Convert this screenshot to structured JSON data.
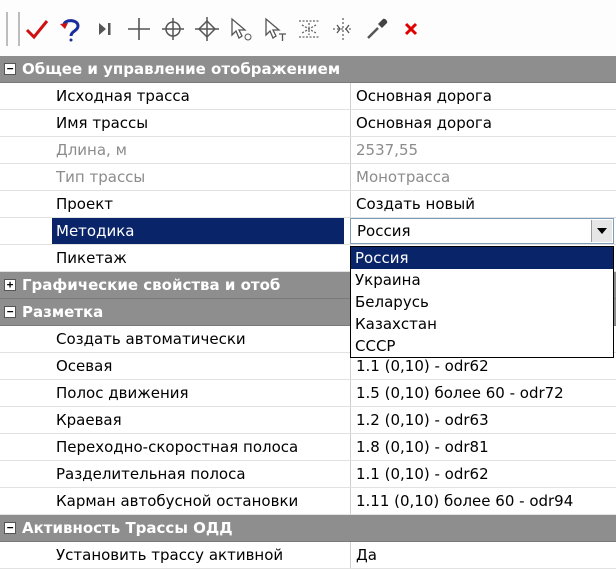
{
  "toolbar": {
    "buttons": [
      {
        "icon": "apply-check-icon"
      },
      {
        "icon": "undo-icon"
      },
      {
        "icon": "step-forward-icon"
      },
      {
        "icon": "add-point-icon"
      },
      {
        "icon": "node-icon"
      },
      {
        "icon": "node-move-icon"
      },
      {
        "icon": "select-cursor-icon"
      },
      {
        "icon": "select-text-cursor-icon"
      },
      {
        "icon": "road-cross-icon"
      },
      {
        "icon": "picket-icon"
      },
      {
        "icon": "pipette-icon"
      },
      {
        "icon": "delete-icon"
      }
    ]
  },
  "categories": [
    {
      "title": "Общее и управление отображением",
      "expander": "−",
      "rows": [
        {
          "name": "Исходная трасса",
          "value": "Основная дорога"
        },
        {
          "name": "Имя трассы",
          "value": "Основная дорога"
        },
        {
          "name": "Длина, м",
          "value": "2537,55"
        },
        {
          "name": "Тип трассы",
          "value": "Монотрасса"
        },
        {
          "name": "Проект",
          "value": "Создать новый"
        },
        {
          "name": "Методика",
          "value": "Россия"
        },
        {
          "name": "Пикетаж",
          "value": ""
        }
      ]
    },
    {
      "title": "Графические свойства и отоб",
      "expander": "+"
    },
    {
      "title": "Разметка",
      "expander": "−",
      "rows": [
        {
          "name": "Создать автоматически",
          "value": ""
        },
        {
          "name": "Осевая",
          "value": "1.1 (0,10) - odr62"
        },
        {
          "name": "Полос движения",
          "value": "1.5 (0,10) более 60 - odr72"
        },
        {
          "name": "Краевая",
          "value": "1.2 (0,10) - odr63"
        },
        {
          "name": "Переходно-скоростная полоса",
          "value": "1.8 (0,10) - odr81"
        },
        {
          "name": "Разделительная полоса",
          "value": "1.1 (0,10) - odr62"
        },
        {
          "name": "Карман автобусной остановки",
          "value": "1.11 (0,10) более 60 - odr94"
        }
      ]
    },
    {
      "title": "Активность Трассы ОДД",
      "expander": "−",
      "rows": [
        {
          "name": "Установить трассу активной",
          "value": "Да"
        }
      ]
    }
  ],
  "dropdown": {
    "selected": "Россия",
    "options": [
      "Россия",
      "Украина",
      "Беларусь",
      "Казахстан",
      "СССР"
    ]
  },
  "colors": {
    "category_bg": "#8e8e8e",
    "selection": "#0a246a",
    "disabled_text": "#8c8c8c",
    "check": "#d01010",
    "delete": "#e00000"
  }
}
